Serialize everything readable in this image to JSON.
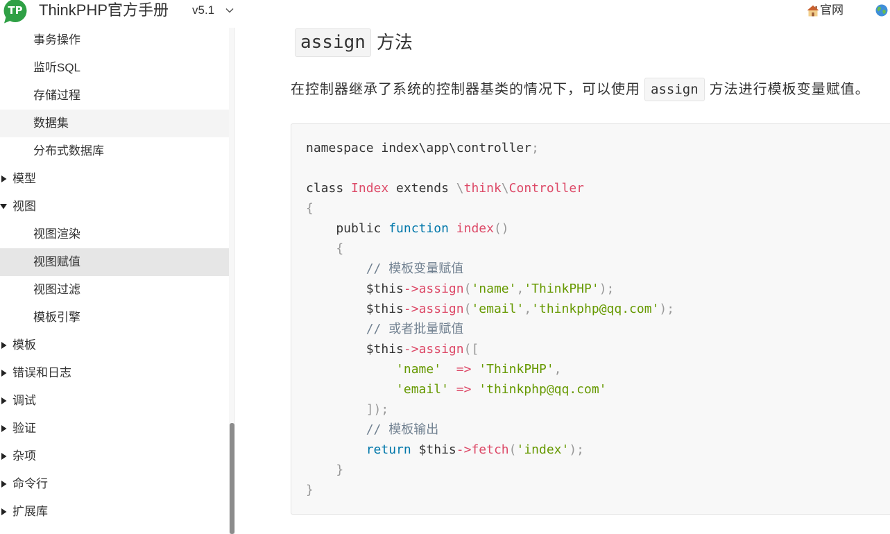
{
  "header": {
    "logo_text": "TP",
    "title": "ThinkPHP官方手册",
    "version": "v5.1",
    "official_site_label": "官网",
    "icons": {
      "logo": "thinkphp-logo-icon",
      "version_toggle": "chevron-down-icon",
      "official_site": "home-icon",
      "language": "globe-icon"
    }
  },
  "sidebar": {
    "icons": {
      "collapsed": "caret-right-icon",
      "expanded": "caret-down-icon"
    },
    "items": [
      {
        "label": "事务操作",
        "level": 2
      },
      {
        "label": "监听SQL",
        "level": 2
      },
      {
        "label": "存储过程",
        "level": 2
      },
      {
        "label": "数据集",
        "level": 2,
        "hovered": true
      },
      {
        "label": "分布式数据库",
        "level": 2
      },
      {
        "label": "模型",
        "level": 1,
        "expanded": false
      },
      {
        "label": "视图",
        "level": 1,
        "expanded": true
      },
      {
        "label": "视图渲染",
        "level": 2
      },
      {
        "label": "视图赋值",
        "level": 2,
        "active": true
      },
      {
        "label": "视图过滤",
        "level": 2
      },
      {
        "label": "模板引擎",
        "level": 2
      },
      {
        "label": "模板",
        "level": 1,
        "expanded": false
      },
      {
        "label": "错误和日志",
        "level": 1,
        "expanded": false
      },
      {
        "label": "调试",
        "level": 1,
        "expanded": false
      },
      {
        "label": "验证",
        "level": 1,
        "expanded": false
      },
      {
        "label": "杂项",
        "level": 1,
        "expanded": false
      },
      {
        "label": "命令行",
        "level": 1,
        "expanded": false
      },
      {
        "label": "扩展库",
        "level": 1,
        "expanded": false
      }
    ]
  },
  "main": {
    "heading": {
      "code": "assign",
      "text": "方法"
    },
    "intro": {
      "before": "在控制器继承了系统的控制器基类的情况下，可以使用",
      "code": "assign",
      "after": "方法进行模板变量赋值。"
    },
    "code_block": {
      "lines": [
        [
          [
            "namespace index\\app\\controller",
            "#333333"
          ],
          [
            ";",
            "#999999"
          ]
        ],
        [],
        [
          [
            "class ",
            "#333333"
          ],
          [
            "Index",
            "#dd4a68"
          ],
          [
            " extends ",
            "#333333"
          ],
          [
            "\\",
            "#999999"
          ],
          [
            "think",
            "#dd4a68"
          ],
          [
            "\\",
            "#999999"
          ],
          [
            "Controller",
            "#dd4a68"
          ]
        ],
        [
          [
            "{",
            "#999999"
          ]
        ],
        [
          [
            "    public ",
            "#333333"
          ],
          [
            "function",
            "#0077aa"
          ],
          [
            " ",
            "#333333"
          ],
          [
            "index",
            "#dd4a68"
          ],
          [
            "()",
            "#999999"
          ]
        ],
        [
          [
            "    ",
            "#333333"
          ],
          [
            "{",
            "#999999"
          ]
        ],
        [
          [
            "        // 模板变量赋值",
            "#708090"
          ]
        ],
        [
          [
            "        $this",
            "#333333"
          ],
          [
            "->",
            "#dd4a68"
          ],
          [
            "assign",
            "#dd4a68"
          ],
          [
            "(",
            "#999999"
          ],
          [
            "'name'",
            "#669900"
          ],
          [
            ",",
            "#999999"
          ],
          [
            "'ThinkPHP'",
            "#669900"
          ],
          [
            ");",
            "#999999"
          ]
        ],
        [
          [
            "        $this",
            "#333333"
          ],
          [
            "->",
            "#dd4a68"
          ],
          [
            "assign",
            "#dd4a68"
          ],
          [
            "(",
            "#999999"
          ],
          [
            "'email'",
            "#669900"
          ],
          [
            ",",
            "#999999"
          ],
          [
            "'thinkphp@qq.com'",
            "#669900"
          ],
          [
            ");",
            "#999999"
          ]
        ],
        [
          [
            "        // 或者批量赋值",
            "#708090"
          ]
        ],
        [
          [
            "        $this",
            "#333333"
          ],
          [
            "->",
            "#dd4a68"
          ],
          [
            "assign",
            "#dd4a68"
          ],
          [
            "([",
            "#999999"
          ]
        ],
        [
          [
            "            ",
            "#333333"
          ],
          [
            "'name'",
            "#669900"
          ],
          [
            "  ",
            "#333333"
          ],
          [
            "=>",
            "#dd4a68"
          ],
          [
            " ",
            "#333333"
          ],
          [
            "'ThinkPHP'",
            "#669900"
          ],
          [
            ",",
            "#999999"
          ]
        ],
        [
          [
            "            ",
            "#333333"
          ],
          [
            "'email'",
            "#669900"
          ],
          [
            " ",
            "#333333"
          ],
          [
            "=>",
            "#dd4a68"
          ],
          [
            " ",
            "#333333"
          ],
          [
            "'thinkphp@qq.com'",
            "#669900"
          ]
        ],
        [
          [
            "        ",
            "#333333"
          ],
          [
            "]);",
            "#999999"
          ]
        ],
        [
          [
            "        // 模板输出",
            "#708090"
          ]
        ],
        [
          [
            "        ",
            "#333333"
          ],
          [
            "return",
            "#0077aa"
          ],
          [
            " $this",
            "#333333"
          ],
          [
            "->",
            "#dd4a68"
          ],
          [
            "fetch",
            "#dd4a68"
          ],
          [
            "(",
            "#999999"
          ],
          [
            "'index'",
            "#669900"
          ],
          [
            ");",
            "#999999"
          ]
        ],
        [
          [
            "    ",
            "#333333"
          ],
          [
            "}",
            "#999999"
          ]
        ],
        [
          [
            "}",
            "#999999"
          ]
        ]
      ]
    }
  },
  "colors": {
    "brand": "#2fa045",
    "text": "#333333",
    "active_item_bg": "#e6e6e6",
    "hover_item_bg": "#f4f4f4",
    "code_bg": "#f8f8f8"
  }
}
